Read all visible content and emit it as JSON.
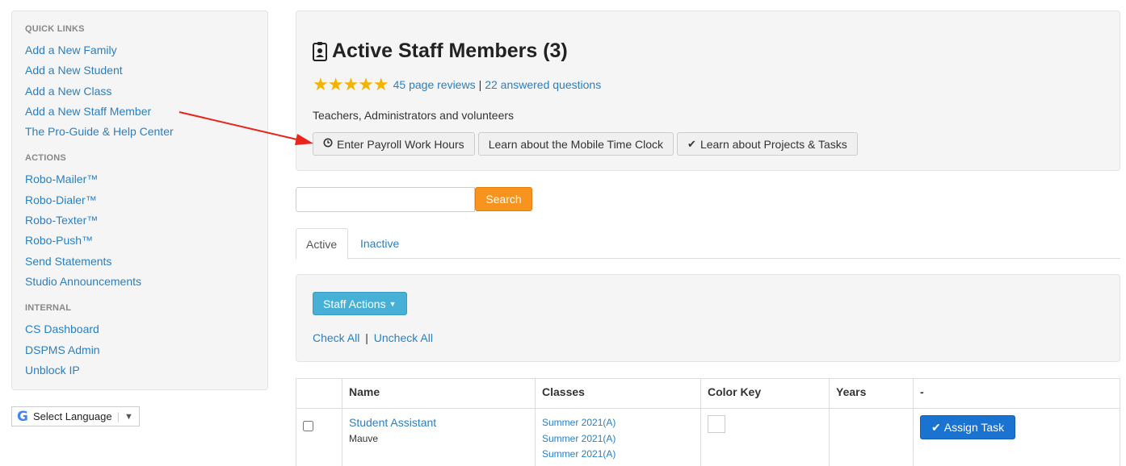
{
  "sidebar": {
    "sections": [
      {
        "heading": "QUICK LINKS",
        "links": [
          "Add a New Family",
          "Add a New Student",
          "Add a New Class",
          "Add a New Staff Member",
          "The Pro-Guide & Help Center"
        ]
      },
      {
        "heading": "ACTIONS",
        "links": [
          "Robo-Mailer™",
          "Robo-Dialer™",
          "Robo-Texter™",
          "Robo-Push™",
          "Send Statements",
          "Studio Announcements"
        ]
      },
      {
        "heading": "INTERNAL",
        "links": [
          "CS Dashboard",
          "DSPMS Admin",
          "Unblock IP"
        ]
      }
    ]
  },
  "language": {
    "label": "Select Language",
    "caret": "▼"
  },
  "header": {
    "title": "Active Staff Members (3)",
    "stars": "★★★★★",
    "reviews_link": "45 page reviews",
    "questions_link": "22 answered questions",
    "separator": "|",
    "subtitle": "Teachers, Administrators and volunteers",
    "buttons": [
      "Enter Payroll Work Hours",
      "Learn about the Mobile Time Clock",
      "Learn about Projects & Tasks"
    ]
  },
  "search": {
    "placeholder": "",
    "button": "Search"
  },
  "tabs": [
    "Active",
    "Inactive"
  ],
  "actions": {
    "staff_actions": "Staff Actions",
    "check_all": "Check All",
    "uncheck_all": "Uncheck All",
    "separator": "|"
  },
  "table": {
    "headers": [
      "",
      "Name",
      "Classes",
      "Color Key",
      "Years",
      "-"
    ],
    "rows": [
      {
        "name": "Student Assistant",
        "color": "Mauve",
        "classes": [
          "Summer 2021(A)",
          "Summer 2021(A)",
          "Summer 2021(A)"
        ],
        "years": "",
        "action": "Assign Task"
      }
    ]
  },
  "colors": {
    "link": "#2a7fc0",
    "search_button": "#f7941d",
    "staff_actions": "#46b0d6",
    "assign_task": "#1a73d1",
    "stars": "#f5b301",
    "arrow": "#e8241c"
  }
}
